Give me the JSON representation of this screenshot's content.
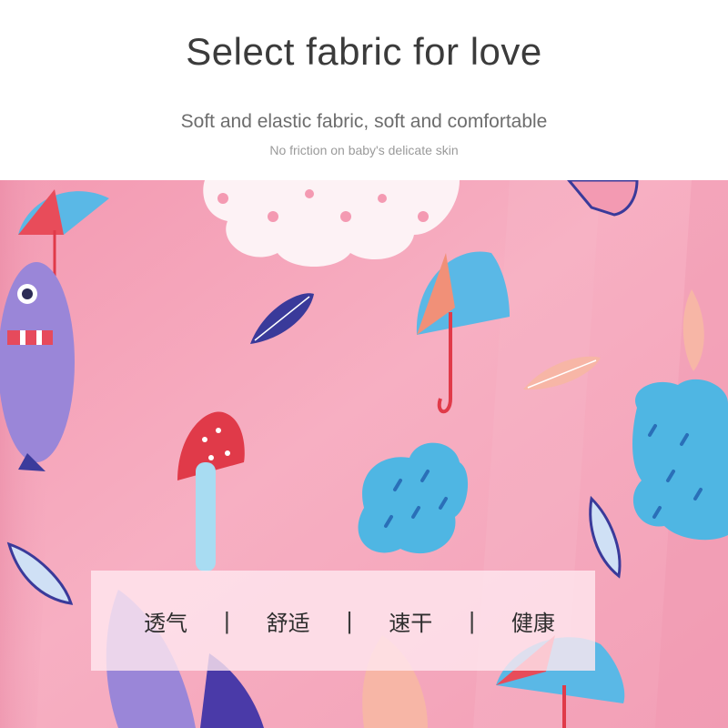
{
  "header": {
    "title": "Select fabric for love",
    "subtitle": "Soft and elastic fabric, soft and comfortable",
    "subtext": "No friction on baby's delicate skin"
  },
  "features": {
    "items": [
      "透气",
      "舒适",
      "速干",
      "健康"
    ],
    "separator": "|"
  },
  "colors": {
    "fabric_pink": "#f7a8bd",
    "cloud_blue": "#4fb6e3",
    "umbrella_red": "#e23a4a",
    "leaf_navy": "#3a3a9a"
  }
}
